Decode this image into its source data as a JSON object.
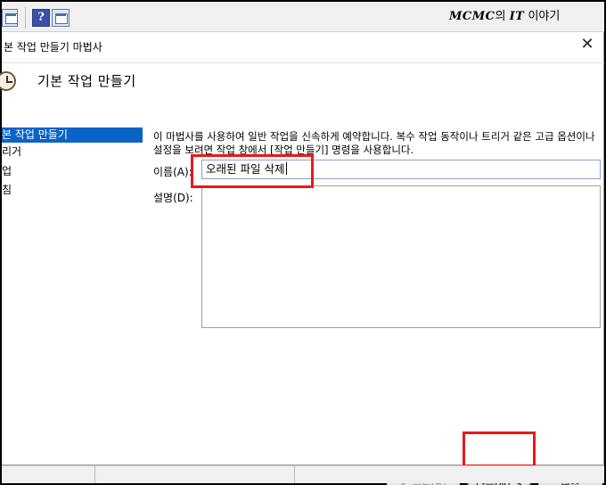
{
  "toolbar": {
    "help_glyph": "?",
    "watermark_bold": "MCMC",
    "watermark_mid": "의 ",
    "watermark_bold2": "IT",
    "watermark_tail": " 이야기"
  },
  "dialog": {
    "title": "본 작업 만들기 마법사",
    "close_glyph": "✕",
    "heading": "기본 작업 만들기"
  },
  "nav": {
    "items": [
      {
        "label": "본 작업 만들기",
        "selected": true
      },
      {
        "label": "리거",
        "selected": false
      },
      {
        "label": "업",
        "selected": false
      },
      {
        "label": "침",
        "selected": false
      }
    ]
  },
  "content": {
    "intro": "이 마법사를 사용하여 일반 작업을 신속하게 예약합니다. 복수 작업 동작이나 트리거 같은 고급 옵션이나 설정을 보려면 작업 창에서 [작업 만들기] 명령을 사용합니다.",
    "name_label": "이름(A):",
    "name_value": "오래된 파일 삭제",
    "desc_label": "설명(D):",
    "desc_value": ""
  },
  "buttons": {
    "back": "< 뒤로(B)",
    "next": "다음(N) >",
    "cancel": "취소"
  },
  "colors": {
    "selection": "#0a64c8",
    "highlight": "#e81a1a",
    "focus_border": "#0078d7"
  }
}
